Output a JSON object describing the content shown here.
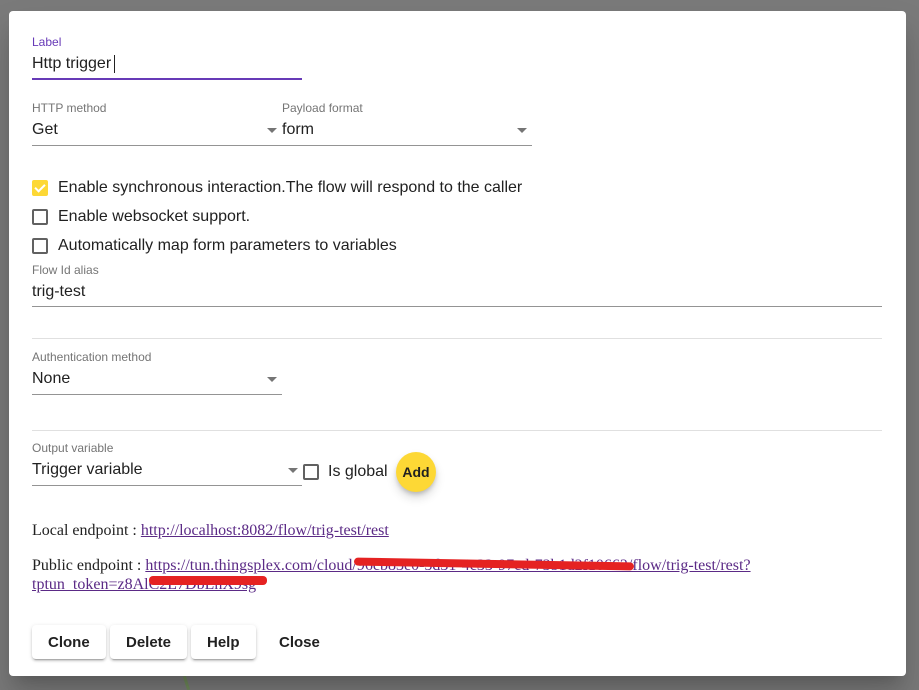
{
  "label_field": {
    "label": "Label",
    "value": "Http trigger"
  },
  "http_method": {
    "label": "HTTP method",
    "value": "Get"
  },
  "payload_format": {
    "label": "Payload format",
    "value": "form"
  },
  "checkboxes": {
    "sync": {
      "label": "Enable synchronous interaction.The flow will respond to the caller",
      "checked": true
    },
    "websocket": {
      "label": "Enable websocket support.",
      "checked": false
    },
    "automap": {
      "label": "Automatically map form parameters to variables",
      "checked": false
    }
  },
  "flow_alias": {
    "label": "Flow Id alias",
    "value": "trig-test"
  },
  "auth": {
    "label": "Authentication method",
    "value": "None"
  },
  "output_var": {
    "label": "Output variable",
    "value": "Trigger variable"
  },
  "is_global": {
    "label": "Is global",
    "checked": false
  },
  "add_button": {
    "label": "Add"
  },
  "endpoints": {
    "local_label": "Local endpoint : ",
    "local_url": "http://localhost:8082/flow/trig-test/rest",
    "public_label": "Public endpoint : ",
    "public_url_line1": "https://tun.thingsplex.com/cloud/96cb83e0-5d31-4c33-97cd-73b1d2f10662/flow/trig-test/rest?",
    "public_url_line2": "tptun_token=z8AlC2L7DbLnX9sg"
  },
  "buttons": {
    "clone": "Clone",
    "delete": "Delete",
    "help": "Help",
    "close": "Close"
  },
  "colors": {
    "accent": "#673ab7",
    "fab": "#fdd835",
    "link": "#5b2a86",
    "redaction": "#e52222"
  }
}
